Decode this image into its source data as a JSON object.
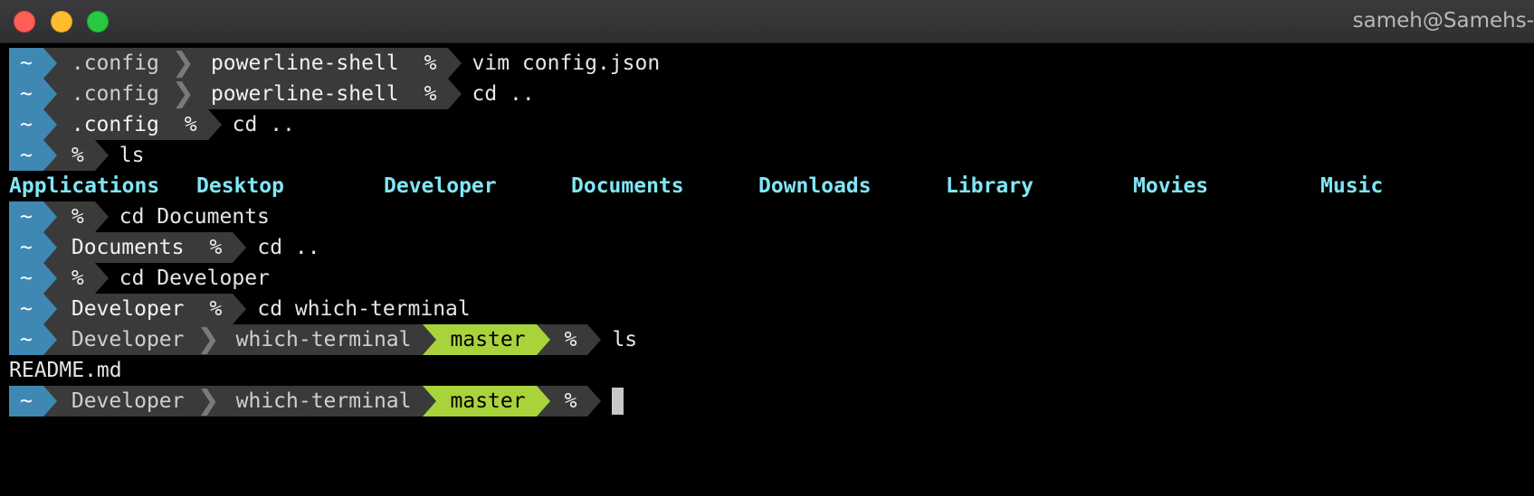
{
  "window": {
    "title": "sameh@Samehs-"
  },
  "colors": {
    "home": "#3f88b4",
    "path": "#3a3a3a",
    "git": "#a9d33a",
    "dir": "#7fe7f5"
  },
  "lines": [
    {
      "home": "~",
      "path": [
        ".config",
        "powerline-shell"
      ],
      "perm": "%",
      "cmd": "vim config.json"
    },
    {
      "home": "~",
      "path": [
        ".config",
        "powerline-shell"
      ],
      "perm": "%",
      "cmd": "cd .."
    },
    {
      "home": "~",
      "path": [
        ".config"
      ],
      "perm": "%",
      "cmd": "cd .."
    },
    {
      "home": "~",
      "path": [],
      "perm": "%",
      "cmd": "ls"
    },
    {
      "ls": [
        "Applications",
        "Desktop",
        "Developer",
        "Documents",
        "Downloads",
        "Library",
        "Movies",
        "Music"
      ]
    },
    {
      "home": "~",
      "path": [],
      "perm": "%",
      "cmd": "cd Documents"
    },
    {
      "home": "~",
      "path": [
        "Documents"
      ],
      "perm": "%",
      "cmd": "cd .."
    },
    {
      "home": "~",
      "path": [],
      "perm": "%",
      "cmd": "cd Developer"
    },
    {
      "home": "~",
      "path": [
        "Developer"
      ],
      "perm": "%",
      "cmd": "cd which-terminal"
    },
    {
      "home": "~",
      "path": [
        "Developer",
        "which-terminal"
      ],
      "git": "master",
      "perm": "%",
      "cmd": "ls"
    },
    {
      "output": "README.md"
    },
    {
      "home": "~",
      "path": [
        "Developer",
        "which-terminal"
      ],
      "git": "master",
      "perm": "%",
      "cmd": "",
      "cursor": true
    }
  ]
}
